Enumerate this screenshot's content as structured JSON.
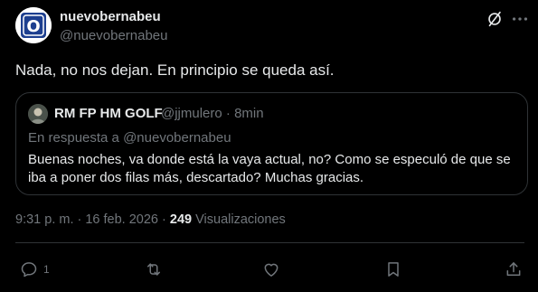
{
  "author": {
    "name": "nuevobernabeu",
    "handle": "@nuevobernabeu",
    "avatar_icon": "nuevobernabeu-logo",
    "avatar_letter": "O"
  },
  "post": {
    "text": "Nada, no nos dejan. En principio se queda así."
  },
  "quoted_post": {
    "author_name": "RM FP HM GOLF",
    "meta": "@jjmulero · 8min",
    "reply_to": "En respuesta a @nuevobernabeu",
    "text_line1": "Buenas noches, va donde está la vaya actual, no? Como se especuló de que se",
    "text_line2": "iba a poner dos filas más, descartado? Muchas gracias."
  },
  "timestamp": {
    "datetime": "9:31 p. m. · 16 feb. 2026 · ",
    "views_count": "249",
    "views_label": " Visualizaciones"
  },
  "actions": {
    "reply_count": "1"
  },
  "icons": [
    "grok-icon",
    "more-icon",
    "reply-icon",
    "repost-icon",
    "like-icon",
    "bookmark-icon",
    "share-icon"
  ],
  "colors": {
    "background": "#000000",
    "text": "#e7e9ea",
    "muted": "#71767b",
    "border": "#2f3336",
    "logo_blue": "#1d3f8f"
  }
}
